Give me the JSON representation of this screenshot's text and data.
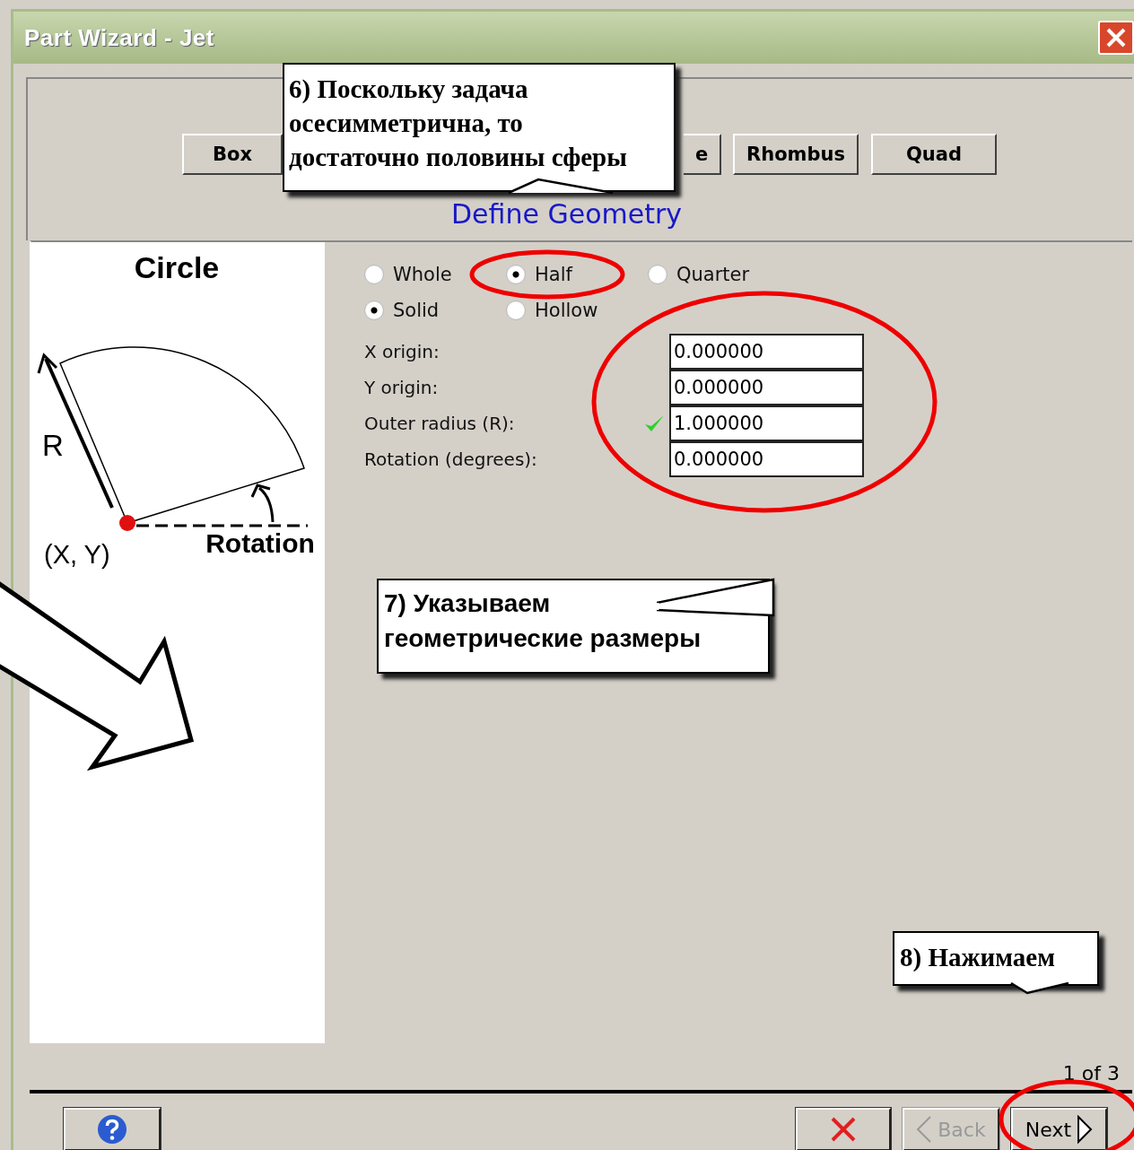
{
  "window": {
    "title": "Part Wizard - Jet"
  },
  "tabs": [
    {
      "label": "Box",
      "selected": false
    },
    {
      "label": "e",
      "selected": false
    },
    {
      "label": "Rhombus",
      "selected": false
    },
    {
      "label": "Quad",
      "selected": false
    }
  ],
  "heading": "Define Geometry",
  "preview": {
    "title": "Circle",
    "radius_label": "R",
    "origin_label": "(X, Y)",
    "rotation_label": "Rotation"
  },
  "extent_options": [
    {
      "label": "Whole",
      "selected": false
    },
    {
      "label": "Half",
      "selected": true
    },
    {
      "label": "Quarter",
      "selected": false
    }
  ],
  "fill_options": [
    {
      "label": "Solid",
      "selected": true
    },
    {
      "label": "Hollow",
      "selected": false
    }
  ],
  "fields": [
    {
      "label": "X origin:",
      "value": "0.000000",
      "valid": false
    },
    {
      "label": "Y origin:",
      "value": "0.000000",
      "valid": false
    },
    {
      "label": "Outer radius (R):",
      "value": "1.000000",
      "valid": true
    },
    {
      "label": "Rotation (degrees):",
      "value": "0.000000",
      "valid": false
    }
  ],
  "page_indicator": "1 of 3",
  "buttons": [
    {
      "kind": "help",
      "disabled": false
    },
    {
      "kind": "cancel",
      "disabled": false
    },
    {
      "kind": "back",
      "label": "Back",
      "disabled": true
    },
    {
      "kind": "next",
      "label": "Next",
      "disabled": false
    }
  ],
  "callouts": [
    {
      "text": "6) Поскольку задача\nосесимметрична, то\nдостаточно половины сферы"
    },
    {
      "text": "7) Указываем\nгеометрические размеры"
    },
    {
      "text": "8) Нажимаем"
    }
  ]
}
